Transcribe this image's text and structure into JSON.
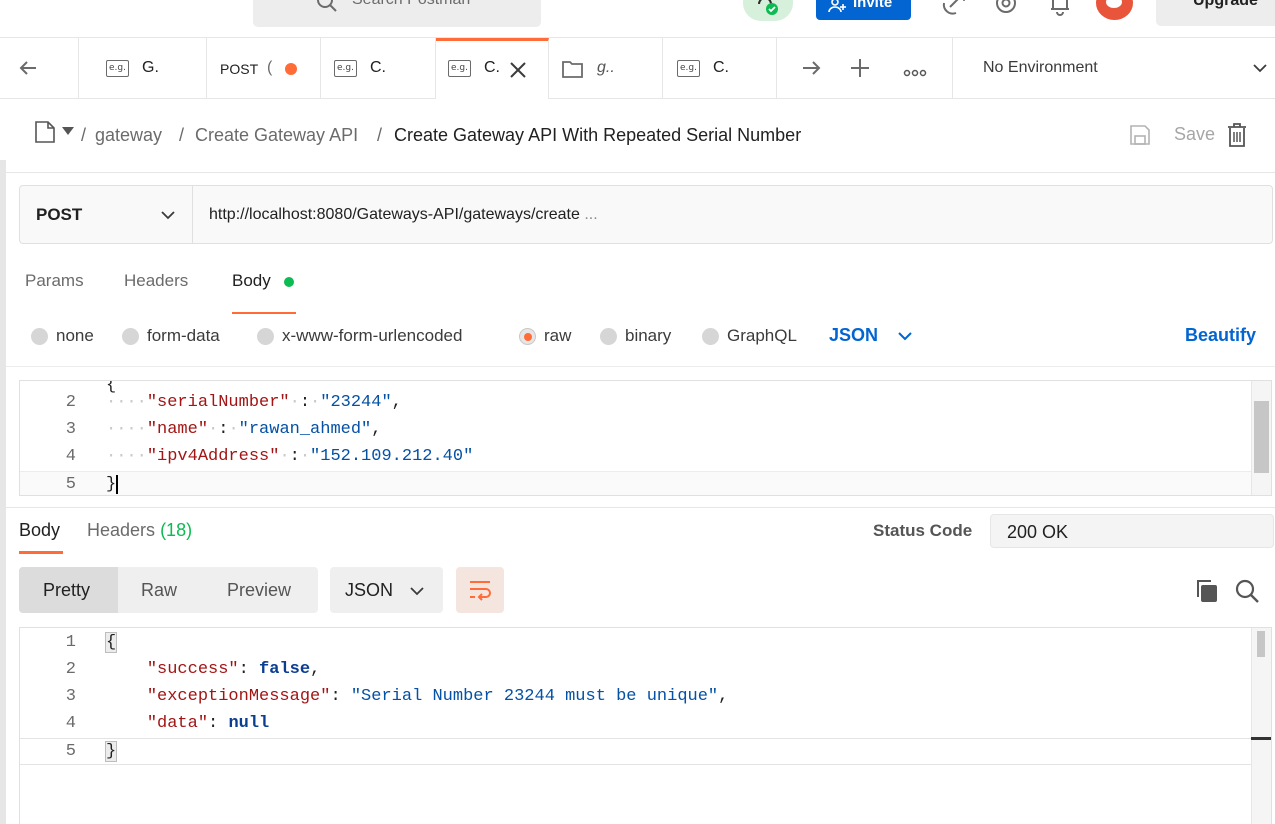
{
  "header": {
    "search_placeholder": "Search Postman",
    "invite_label": "Invite",
    "upgrade_label": "Upgrade"
  },
  "tabs": [
    {
      "icon": "e.g.",
      "label": "G."
    },
    {
      "method": "POST",
      "label": "(",
      "unsaved": true
    },
    {
      "icon": "e.g.",
      "label": "C."
    },
    {
      "icon": "e.g.",
      "label": "C.",
      "active": true
    },
    {
      "icon": "folder-icon",
      "label": "g.."
    },
    {
      "icon": "e.g.",
      "label": "C."
    }
  ],
  "environment": {
    "label": "No Environment"
  },
  "breadcrumb": {
    "items": [
      "gateway",
      "Create Gateway API"
    ],
    "current": "Create Gateway API With Repeated Serial Number",
    "separator": "/"
  },
  "actions": {
    "save_label": "Save"
  },
  "request": {
    "method": "POST",
    "url": "http://localhost:8080/Gateways-API/gateways/create",
    "url_ellipsis": "..."
  },
  "request_tabs": {
    "params": "Params",
    "headers": "Headers",
    "body": "Body"
  },
  "body_types": {
    "none": "none",
    "form_data": "form-data",
    "urlencoded": "x-www-form-urlencoded",
    "raw": "raw",
    "binary": "binary",
    "graphql": "GraphQL",
    "selected": "raw",
    "format": "JSON",
    "beautify": "Beautify"
  },
  "request_body": {
    "lines": [
      {
        "n": "2",
        "key": "\"serialNumber\"",
        "value": "\"23244\"",
        "tail": ","
      },
      {
        "n": "3",
        "key": "\"name\"",
        "value": "\"rawan_ahmed\"",
        "tail": ","
      },
      {
        "n": "4",
        "key": "\"ipv4Address\"",
        "value": "\"152.109.212.40\"",
        "tail": ""
      },
      {
        "n": "5",
        "text": "}"
      }
    ]
  },
  "response_tabs": {
    "body": "Body",
    "headers": "Headers",
    "headers_count": "(18)"
  },
  "status": {
    "label": "Status Code",
    "value": "200 OK"
  },
  "response_view": {
    "pretty": "Pretty",
    "raw": "Raw",
    "preview": "Preview",
    "format": "JSON"
  },
  "response_body": {
    "lines": [
      {
        "n": "1",
        "text": "{"
      },
      {
        "n": "2",
        "key": "\"success\"",
        "value": "false",
        "tail": ","
      },
      {
        "n": "3",
        "key": "\"exceptionMessage\"",
        "value": "\"Serial Number 23244 must be unique\"",
        "tail": ","
      },
      {
        "n": "4",
        "key": "\"data\"",
        "value": "null",
        "tail": ""
      },
      {
        "n": "5",
        "text": "}"
      }
    ]
  },
  "colors": {
    "accent": "#ff6c37",
    "link_blue": "#0265d2",
    "success_green": "#0cbb52"
  }
}
